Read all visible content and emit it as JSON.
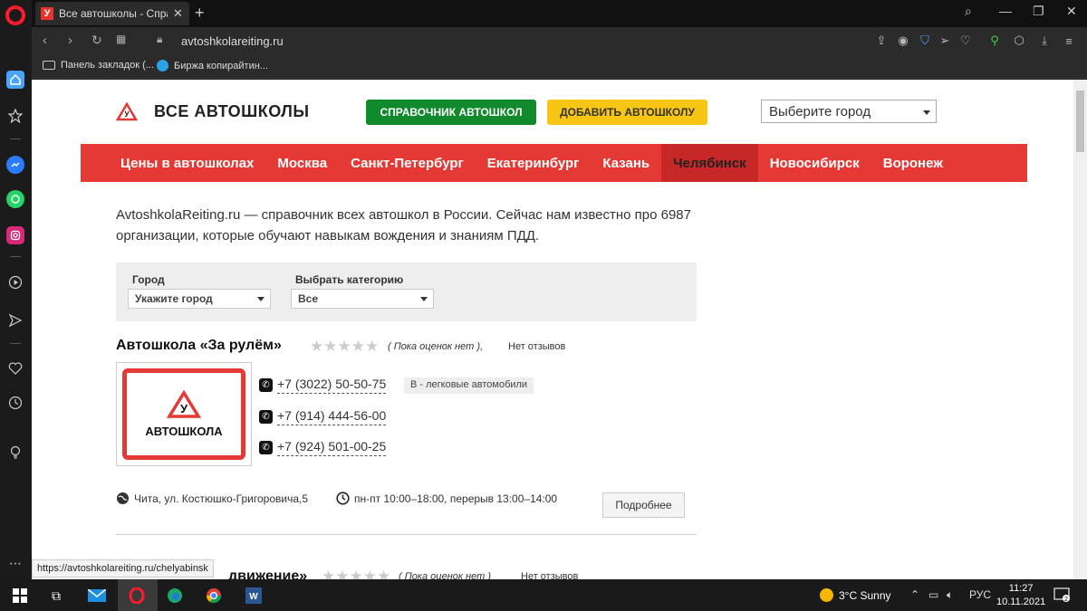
{
  "browser": {
    "tab_title": "Все автошколы - Справочник",
    "tab_favicon": "У",
    "url": "avtoshkolareiting.ru",
    "bookmarks": [
      {
        "label": "Панель закладок (..."
      },
      {
        "label": "Биржа копирайтин..."
      }
    ],
    "status_link": "https://avtoshkolareiting.ru/chelyabinsk"
  },
  "header": {
    "site_title": "ВСЕ АВТОШКОЛЫ",
    "directory_button": "СПРАВОЧНИК АВТОШКОЛ",
    "add_button": "ДОБАВИТЬ АВТОШКОЛУ",
    "city_select": "Выберите город"
  },
  "nav": {
    "items": [
      {
        "label": "Цены в автошколах"
      },
      {
        "label": "Москва"
      },
      {
        "label": "Санкт-Петербург"
      },
      {
        "label": "Екатеринбург"
      },
      {
        "label": "Казань"
      },
      {
        "label": "Челябинск",
        "active": true
      },
      {
        "label": "Новосибирск"
      },
      {
        "label": "Воронеж"
      }
    ]
  },
  "intro": "AvtoshkolaReiting.ru — справочник всех автошкол в России. Сейчас нам известно про 6987 организации, которые обучают навыкам вождения и знаниям ПДД.",
  "filter": {
    "city_label": "Город",
    "city_value": "Укажите город",
    "category_label": "Выбрать категорию",
    "category_value": "Все"
  },
  "schools": [
    {
      "name": "Автошкола «За рулём»",
      "ratings": "( Пока оценок нет )",
      "ratings_sep": ",",
      "reviews": "Нет отзывов",
      "image_caption": "АВТОШКОЛА",
      "image_sign": "У",
      "phones": [
        "+7 (3022) 50-50-75",
        "+7 (914) 444-56-00",
        "+7 (924) 501-00-25"
      ],
      "category": "B - легковые автомобили",
      "address": "Чита, ул. Костюшко-Григоровича,5",
      "hours": "пн-пт 10:00–18:00, перерыв 13:00–14:00",
      "more_button": "Подробнее"
    },
    {
      "name": "движение»",
      "ratings": "( Пока оценок нет )",
      "reviews": "Нет отзывов"
    }
  ],
  "taskbar": {
    "weather": "3°C  Sunny",
    "lang": "РУС",
    "time": "11:27",
    "date": "10.11.2021",
    "notifications": "2"
  }
}
